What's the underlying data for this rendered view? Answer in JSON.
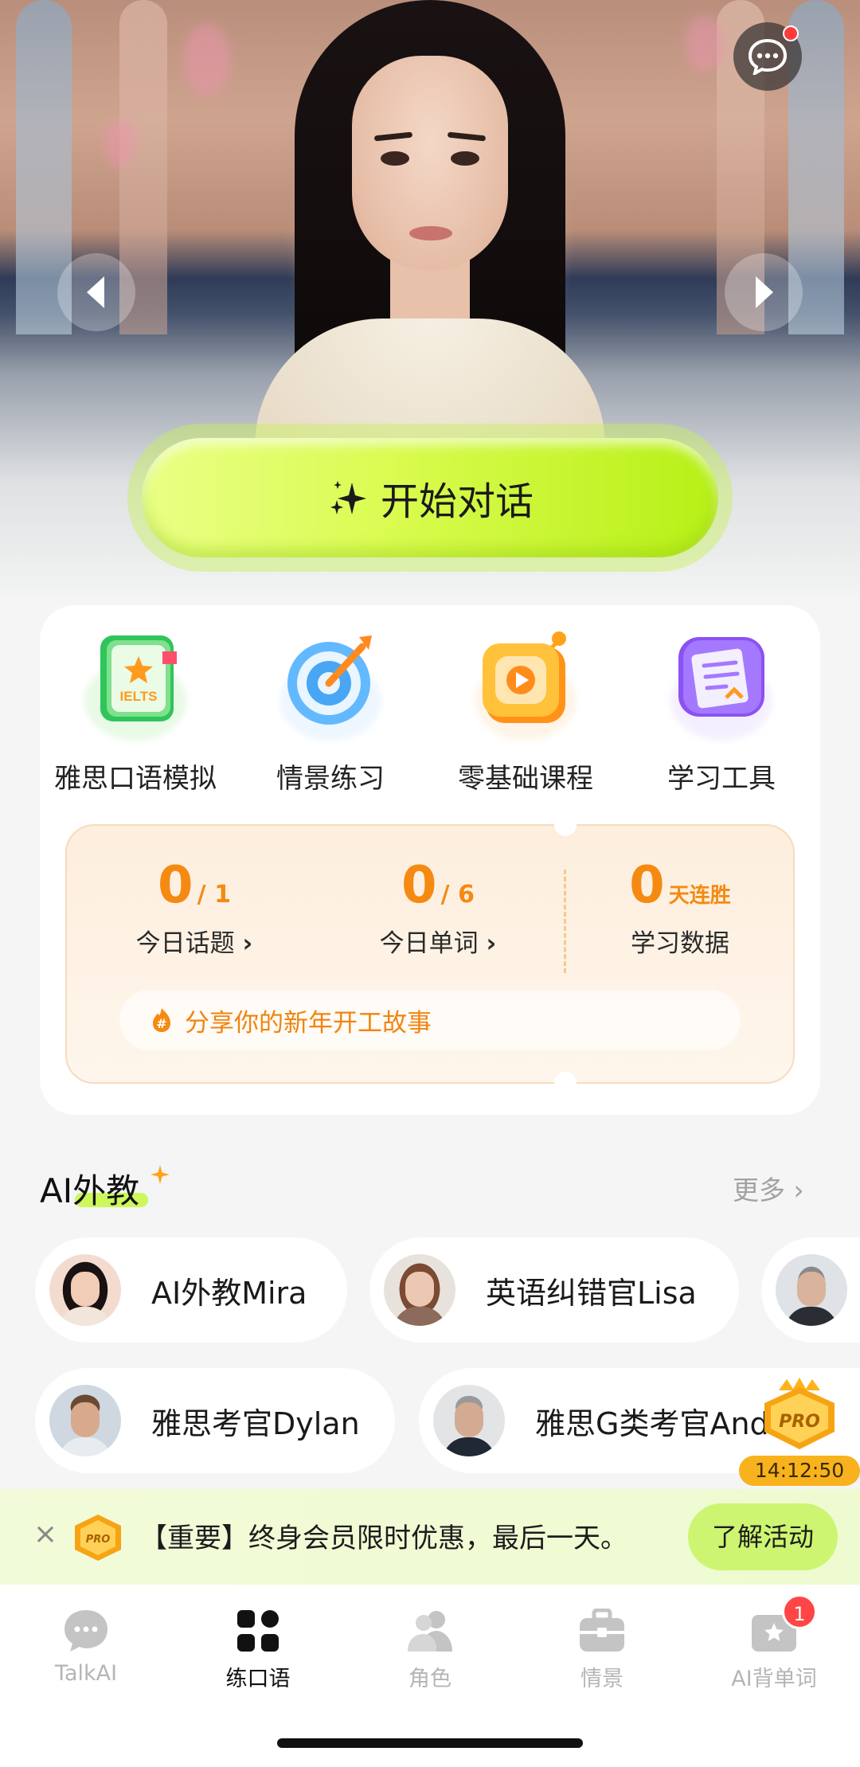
{
  "hero": {
    "start_label": "开始对话"
  },
  "features": [
    {
      "label": "雅思口语模拟",
      "icon": "ielts-book-icon"
    },
    {
      "label": "情景练习",
      "icon": "target-icon"
    },
    {
      "label": "零基础课程",
      "icon": "play-tv-icon"
    },
    {
      "label": "学习工具",
      "icon": "document-tool-icon"
    }
  ],
  "stats": {
    "topics": {
      "value": "0",
      "total": "/ 1",
      "caption": "今日话题"
    },
    "words": {
      "value": "0",
      "total": "/ 6",
      "caption": "今日单词"
    },
    "streak": {
      "value": "0",
      "unit": "天连胜",
      "caption": "学习数据"
    },
    "share_text": "分享你的新年开工故事"
  },
  "ai_teachers": {
    "title": "AI外教",
    "more_label": "更多",
    "row1": [
      {
        "name": "AI外教Mira"
      },
      {
        "name": "英语纠错官Lisa"
      },
      {
        "name": ""
      }
    ],
    "row2": [
      {
        "name": "雅思考官Dylan"
      },
      {
        "name": "雅思G类考官And"
      }
    ]
  },
  "pro_timer": {
    "badge_text": "PRO",
    "countdown": "14:12:50"
  },
  "promo": {
    "badge_text": "PRO",
    "text": "【重要】终身会员限时优惠，最后一天。",
    "cta": "了解活动"
  },
  "tabs": [
    {
      "label": "TalkAI",
      "icon": "chat-bubble-icon",
      "active": false
    },
    {
      "label": "练口语",
      "icon": "grid-apps-icon",
      "active": true
    },
    {
      "label": "角色",
      "icon": "people-icon",
      "active": false
    },
    {
      "label": "情景",
      "icon": "briefcase-icon",
      "active": false
    },
    {
      "label": "AI背单词",
      "icon": "word-card-icon",
      "active": false,
      "badge": "1"
    }
  ],
  "colors": {
    "accent_green": "#d9fb4e",
    "accent_orange": "#f58a12",
    "badge_red": "#ff4545"
  }
}
